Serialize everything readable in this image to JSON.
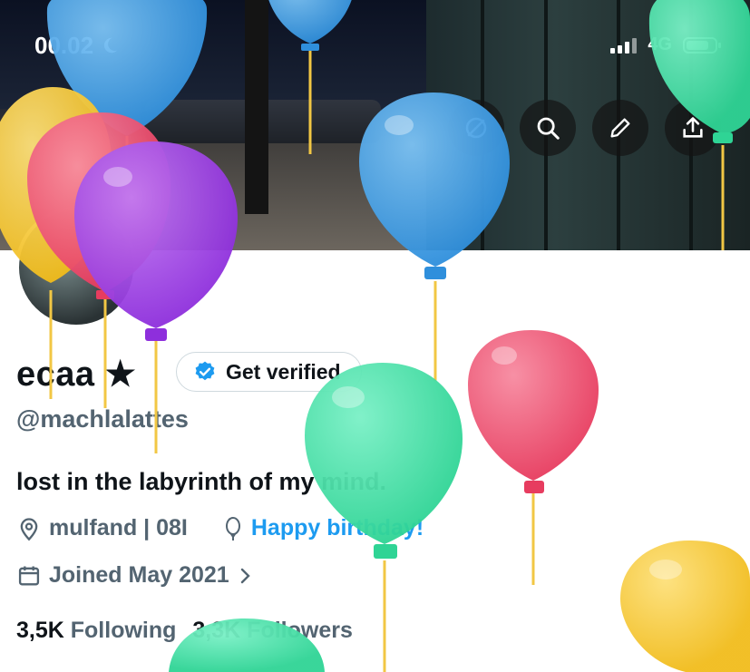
{
  "status_bar": {
    "time": "00.02",
    "network": "4G",
    "moon_icon": "moon-icon",
    "signal_icon": "signal-bars-icon",
    "battery_icon": "battery-icon"
  },
  "banner_actions": [
    {
      "name": "translate-icon"
    },
    {
      "name": "search-icon"
    },
    {
      "name": "edit-pencil-icon"
    },
    {
      "name": "share-upload-icon"
    }
  ],
  "profile": {
    "display_name": "ecaa ★",
    "get_verified_label": "Get verified",
    "handle": "@machlalattes",
    "bio": "lost in the labyrinth of my mind.",
    "location": "mulfand | 08I",
    "birthday_text": "Happy birthday!",
    "joined": "Joined May 2021",
    "following_count": "3,5K",
    "following_label": "Following",
    "followers_count": "3,3K",
    "followers_label": "Followers"
  },
  "colors": {
    "accent": "#1d9bf0",
    "muted_text": "#536471",
    "balloon_blue": "#3d9ee6",
    "balloon_green": "#3ddba0",
    "balloon_red": "#ec4a6a",
    "balloon_purple": "#9b3fe0",
    "balloon_yellow": "#f4c52a"
  }
}
